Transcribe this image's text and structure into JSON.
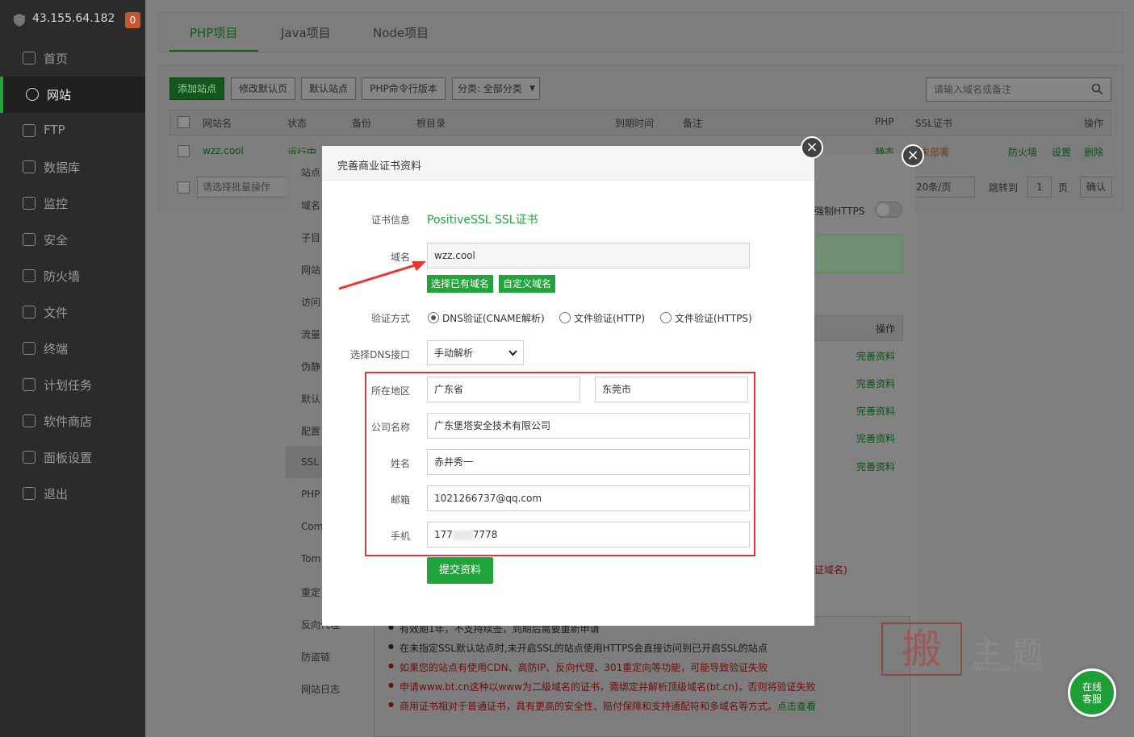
{
  "server": {
    "ip": "43.155.64.182",
    "badge": "0"
  },
  "nav": [
    "首页",
    "网站",
    "FTP",
    "数据库",
    "监控",
    "安全",
    "防火墙",
    "文件",
    "终端",
    "计划任务",
    "软件商店",
    "面板设置",
    "退出"
  ],
  "tabs": [
    "PHP项目",
    "Java项目",
    "Node项目"
  ],
  "toolbar": {
    "add": "添加站点",
    "edit_default": "修改默认页",
    "default_site": "默认站点",
    "php_cli": "PHP命令行版本",
    "category": "分类: 全部分类",
    "search_placeholder": "请输入域名或备注"
  },
  "table": {
    "headers": [
      "网站名",
      "状态",
      "备份",
      "根目录",
      "到期时间",
      "备注",
      "PHP",
      "SSL证书",
      "操作"
    ],
    "row": {
      "name": "wzz.cool",
      "status": "运行中",
      "php": "静态",
      "ssl": "未部署",
      "actions": [
        "防火墙",
        "设置",
        "删除"
      ]
    },
    "batch_placeholder": "请选择批量操作",
    "per_page": "20条/页",
    "goto": "跳转到",
    "page": "1",
    "page_unit": "页",
    "confirm": "确认"
  },
  "site_panel": {
    "items": [
      "站点",
      "域名",
      "子目",
      "网站",
      "访问",
      "流量",
      "伪静",
      "默认",
      "配置",
      "SSL",
      "PHP",
      "Com",
      "Tom",
      "重定",
      "反向代理",
      "防盗链",
      "网站日志"
    ],
    "force_https": "强制HTTPS",
    "ops_header": "操作",
    "complete": [
      "完善资料",
      "完善资料",
      "完善资料",
      "完善资料",
      "完善资料"
    ],
    "red_hint": "证域名)",
    "tips": [
      {
        "text": "有效期1年，不支持续签，到期后需要重新申请",
        "color": "#1a1a1a"
      },
      {
        "text": "在未指定SSL默认站点时,未开启SSL的站点使用HTTPS会直接访问到已开启SSL的站点",
        "color": "#1a1a1a"
      },
      {
        "text": "如果您的站点有使用CDN、高防IP、反向代理、301重定向等功能，可能导致验证失败",
        "color": "#6d0e0e"
      },
      {
        "text": "申请www.bt.cn这种以www为二级域名的证书，需绑定并解析顶级域名(bt.cn)，否则将验证失败",
        "color": "#6d0e0e"
      },
      {
        "text": "商用证书相对于普通证书，具有更高的安全性、赔付保障和支持通配符和多域名等方式。",
        "color": "#6d0e0e"
      }
    ],
    "tip_link": "点击查看"
  },
  "modal": {
    "title": "完善商业证书资料",
    "cert_label": "证书信息",
    "cert_value": "PositiveSSL SSL证书",
    "domain_label": "域名",
    "domain_value": "wzz.cool",
    "btn_choose": "选择已有域名",
    "btn_custom": "自定义域名",
    "verify_label": "验证方式",
    "verify_options": [
      "DNS验证(CNAME解析)",
      "文件验证(HTTP)",
      "文件验证(HTTPS)"
    ],
    "dns_label": "选择DNS接口",
    "dns_value": "手动解析",
    "region_label": "所在地区",
    "province": "广东省",
    "city": "东莞市",
    "company_label": "公司名称",
    "company": "广东堡塔安全技术有限公司",
    "name_label": "姓名",
    "name": "赤井秀一",
    "email_label": "邮箱",
    "email": "1021266737@qq.com",
    "phone_label": "手机",
    "phone_a": "177",
    "phone_b": "7778",
    "submit": "提交资料"
  },
  "watermark": {
    "char": "搬",
    "text": "主题",
    "url": "WWW.BANZHUTI.COM"
  },
  "online": [
    "在线",
    "客服"
  ],
  "colors": {
    "green": "#20a53a",
    "red": "#d9363e",
    "sidebar": "#2b2b2b"
  }
}
